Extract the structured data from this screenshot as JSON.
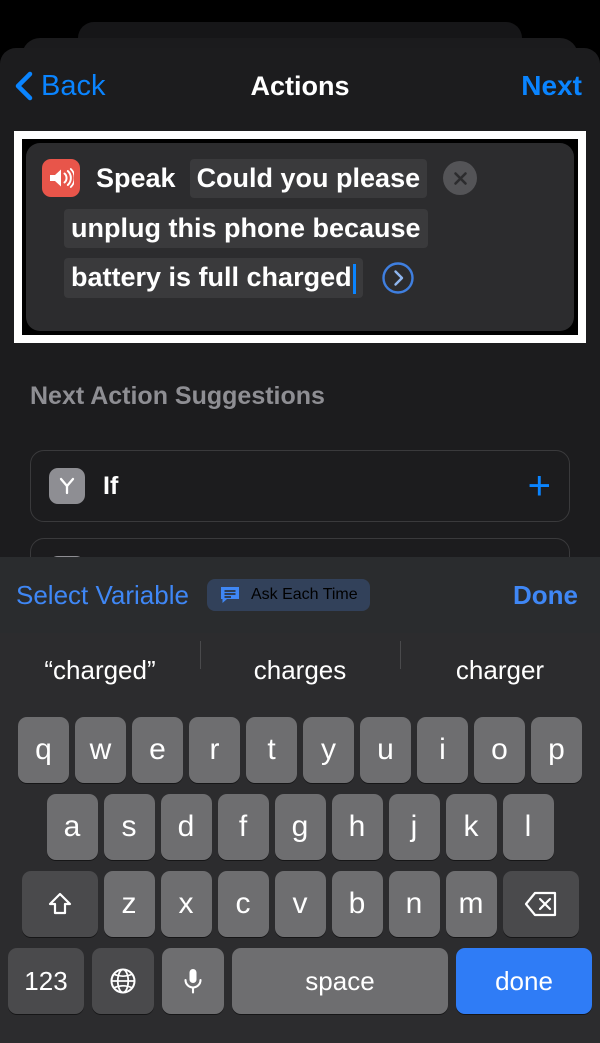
{
  "nav": {
    "back_label": "Back",
    "title": "Actions",
    "next_label": "Next",
    "back_icon": "chevron-left-icon"
  },
  "action": {
    "icon": "speaker-wave-icon",
    "icon_color": "#e8554a",
    "label": "Speak",
    "text_line1": "Could you please",
    "text_line2": "unplug this phone because",
    "text_line3": "battery is full charged",
    "full_text": "Could you please unplug this phone because battery is full charged",
    "close_icon": "close-circle-icon",
    "disclosure_icon": "chevron-right-circle-icon"
  },
  "suggestions_section": {
    "header": "Next Action Suggestions",
    "items": [
      {
        "icon": "branch-if-icon",
        "label": "If",
        "add_icon": "plus-icon",
        "add_label": "+"
      },
      {
        "icon": "action-icon",
        "label": "",
        "add_icon": "plus-icon",
        "add_label": "+"
      }
    ]
  },
  "keyboard_toolbar": {
    "select_variable_label": "Select Variable",
    "ask_each_time_label": "Ask Each Time",
    "ask_each_time_icon": "speech-bubble-icon",
    "done_label": "Done"
  },
  "predictions": [
    "“charged”",
    "charges",
    "charger"
  ],
  "keyboard": {
    "row1": [
      "q",
      "w",
      "e",
      "r",
      "t",
      "y",
      "u",
      "i",
      "o",
      "p"
    ],
    "row2": [
      "a",
      "s",
      "d",
      "f",
      "g",
      "h",
      "j",
      "k",
      "l"
    ],
    "row3": [
      "z",
      "x",
      "c",
      "v",
      "b",
      "n",
      "m"
    ],
    "shift_icon": "shift-up-arrow-icon",
    "backspace_icon": "backspace-delete-icon",
    "numbers_label": "123",
    "globe_icon": "globe-language-icon",
    "mic_icon": "microphone-icon",
    "space_label": "space",
    "done_label": "done"
  },
  "colors": {
    "accent_blue": "#0a84ff",
    "key_blue": "#2f7cf6",
    "speak_red": "#e8554a",
    "sheet_bg": "#1c1c1e",
    "card_bg": "#2c2c2e",
    "highlight_border": "#ffffff"
  }
}
